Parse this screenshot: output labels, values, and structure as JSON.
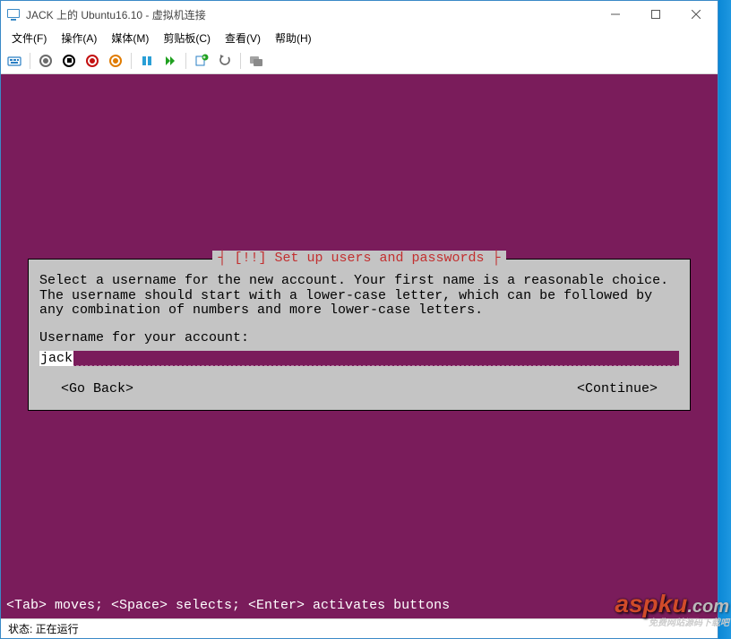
{
  "window": {
    "title": "JACK 上的 Ubuntu16.10 - 虚拟机连接"
  },
  "menu": {
    "file": "文件(F)",
    "action": "操作(A)",
    "media": "媒体(M)",
    "clipboard": "剪贴板(C)",
    "view": "查看(V)",
    "help": "帮助(H)"
  },
  "dialog": {
    "title": "[!!] Set up users and passwords",
    "body": "Select a username for the new account. Your first name is a reasonable choice. The username should start with a lower-case letter, which can be followed by any combination of numbers and more lower-case letters.",
    "prompt": "Username for your account:",
    "value": "jack",
    "go_back": "<Go Back>",
    "continue": "<Continue>"
  },
  "helpbar": "<Tab> moves; <Space> selects; <Enter> activates buttons",
  "statusbar": "状态: 正在运行",
  "watermark": {
    "main": "aspku",
    "suffix": ".com",
    "sub": "免费网站源码下载吧"
  }
}
